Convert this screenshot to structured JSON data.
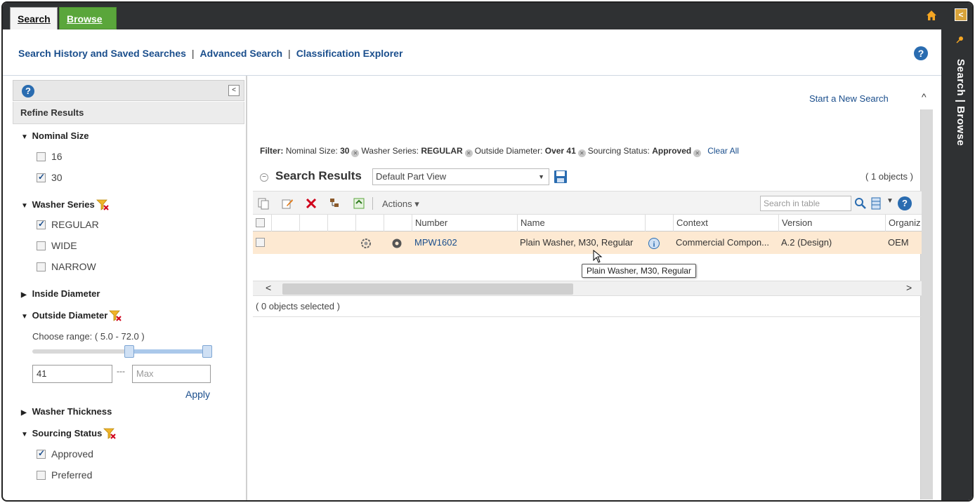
{
  "tabs": {
    "search": "Search",
    "browse": "Browse"
  },
  "side_strip": {
    "label": "Search | Browse"
  },
  "nav_links": {
    "history": "Search History and Saved Searches",
    "advanced": "Advanced Search",
    "classification": "Classification Explorer",
    "sep": "|"
  },
  "help_label": "?",
  "refine": {
    "title": "Refine Results",
    "nominal_size": {
      "label": "Nominal Size",
      "options": [
        {
          "label": "16",
          "checked": false
        },
        {
          "label": "30",
          "checked": true
        }
      ]
    },
    "washer_series": {
      "label": "Washer Series",
      "options": [
        {
          "label": "REGULAR",
          "checked": true
        },
        {
          "label": "WIDE",
          "checked": false
        },
        {
          "label": "NARROW",
          "checked": false
        }
      ]
    },
    "inside_diameter": {
      "label": "Inside Diameter"
    },
    "outside_diameter": {
      "label": "Outside Diameter",
      "range_label": "Choose range: ( 5.0 - 72.0 )",
      "min_value": "41",
      "max_placeholder": "Max",
      "dash": "---",
      "apply": "Apply"
    },
    "washer_thickness": {
      "label": "Washer Thickness"
    },
    "sourcing_status": {
      "label": "Sourcing Status",
      "options": [
        {
          "label": "Approved",
          "checked": true
        },
        {
          "label": "Preferred",
          "checked": false
        }
      ]
    }
  },
  "main": {
    "new_search": "Start a New Search",
    "filter": {
      "prefix": "Filter:",
      "items": [
        {
          "key": "Nominal Size:",
          "value": "30"
        },
        {
          "key": "Washer Series:",
          "value": "REGULAR"
        },
        {
          "key": "Outside Diameter:",
          "value": "Over 41"
        },
        {
          "key": "Sourcing Status:",
          "value": "Approved"
        }
      ],
      "clear_all": "Clear All"
    },
    "results_title": "Search Results",
    "view": "Default Part View",
    "object_count": "( 1 objects )",
    "actions": "Actions ▾",
    "table_search_placeholder": "Search in table",
    "columns": [
      "Number",
      "Name",
      "Context",
      "Version",
      "Organiz"
    ],
    "row": {
      "number": "MPW1602",
      "name": "Plain Washer, M30, Regular",
      "context": "Commercial Compon...",
      "version": "A.2 (Design)",
      "org": "OEM"
    },
    "tooltip": "Plain Washer, M30, Regular",
    "selected": "( 0 objects selected )"
  },
  "colors": {
    "link": "#1a4e8c",
    "browse_tab": "#5aa63b",
    "row_highlight": "#fde9d2",
    "dark_bar": "#2f3133"
  }
}
